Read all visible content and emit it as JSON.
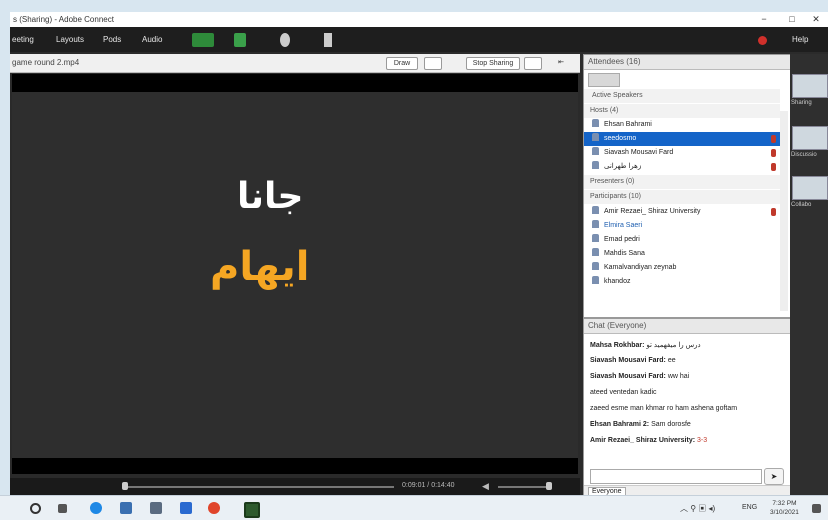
{
  "window": {
    "title": "s (Sharing) - Adobe Connect",
    "min": "−",
    "max": "□",
    "close": "✕"
  },
  "menubar": {
    "items": [
      "eeting",
      "Layouts",
      "Pods",
      "Audio"
    ],
    "help": "Help"
  },
  "share": {
    "filename": "game round 2.mp4",
    "draw_label": "Draw",
    "stop_label": "Stop Sharing",
    "word_top": "جانا",
    "word_bottom": "ایهام",
    "time": "0:09:01 / 0:14:40"
  },
  "attendees": {
    "title": "Attendees  (16)",
    "active_speakers": "Active Speakers",
    "hosts_header": "Hosts (4)",
    "hosts": [
      "Ehsan Bahrami",
      "seedosmo",
      "Siavash Mousavi Fard",
      "زهرا طهرانی"
    ],
    "presenters_header": "Presenters (0)",
    "participants_header": "Participants (10)",
    "participants": [
      "Amir Rezaei_ Shiraz University",
      "Elmira Saeri",
      "Emad pedri",
      "Mahdis Sana",
      "Kamalvandiyan zeynab",
      "khandoz"
    ]
  },
  "chat": {
    "title": "Chat  (Everyone)",
    "messages": [
      {
        "name": "Mahsa Rokhbar:",
        "text": "درس را میفهمید تو"
      },
      {
        "name": "Siavash Mousavi Fard:",
        "text": "ee"
      },
      {
        "name": "Siavash Mousavi Fard:",
        "text": "ww hai"
      },
      {
        "name": "",
        "text": "ateed ventedan kadic"
      },
      {
        "name": "",
        "text": "zaeed esme man khmar ro ham ashena goftam"
      },
      {
        "name": "Ehsan Bahrami 2:",
        "text": "Sam dorosfe"
      },
      {
        "name": "Amir Rezaei_ Shiraz University:",
        "text": "3-3"
      }
    ],
    "recipient": "Everyone"
  },
  "rail": {
    "labels": [
      "Sharing",
      "Discussio",
      "Collabo"
    ]
  },
  "taskbar": {
    "time": "7:32 PM",
    "date": "3/10/2021",
    "lang": "ENG"
  }
}
